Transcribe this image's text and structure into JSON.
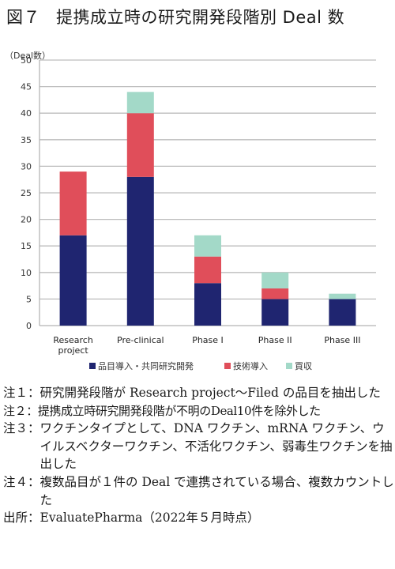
{
  "figure": {
    "number_label": "図７",
    "title": "提携成立時の研究開発段階別 Deal 数"
  },
  "chart_data": {
    "type": "bar",
    "stacked": true,
    "title": "提携成立時の研究開発段階別 Deal 数",
    "ylabel": "（Deal数）",
    "xlabel": "",
    "ylim": [
      0,
      50
    ],
    "yticks": [
      0,
      5,
      10,
      15,
      20,
      25,
      30,
      35,
      40,
      45,
      50
    ],
    "grid": true,
    "legend_position": "bottom",
    "categories": [
      "Research project",
      "Pre-clinical",
      "Phase I",
      "Phase II",
      "Phase III"
    ],
    "category_lines": [
      [
        "Research",
        "project"
      ],
      [
        "Pre-clinical"
      ],
      [
        "Phase I"
      ],
      [
        "Phase II"
      ],
      [
        "Phase III"
      ]
    ],
    "series": [
      {
        "name": "品目導入・共同研究開発",
        "color": "#1f2570",
        "values": [
          17,
          28,
          8,
          5,
          5
        ]
      },
      {
        "name": "技術導入",
        "color": "#e04e5a",
        "values": [
          12,
          12,
          5,
          2,
          0
        ]
      },
      {
        "name": "買収",
        "color": "#a3d9c8",
        "values": [
          0,
          4,
          4,
          3,
          1
        ]
      }
    ]
  },
  "notes": [
    {
      "label": "注１：",
      "text": "研究開発段階が Research project～Filed の品目を抽出した"
    },
    {
      "label": "注２：",
      "text": "提携成立時研究開発段階が不明のDeal10件を除外した"
    },
    {
      "label": "注３：",
      "text": "ワクチンタイプとして、DNA ワクチン、mRNA ワクチン、ウイルスベクターワクチン、不活化ワクチン、弱毒生ワクチンを抽出した"
    },
    {
      "label": "注４：",
      "text": "複数品目が１件の Deal で連携されている場合、複数カウントした"
    },
    {
      "label": "出所：",
      "text": "EvaluatePharma（2022年５月時点）"
    }
  ]
}
